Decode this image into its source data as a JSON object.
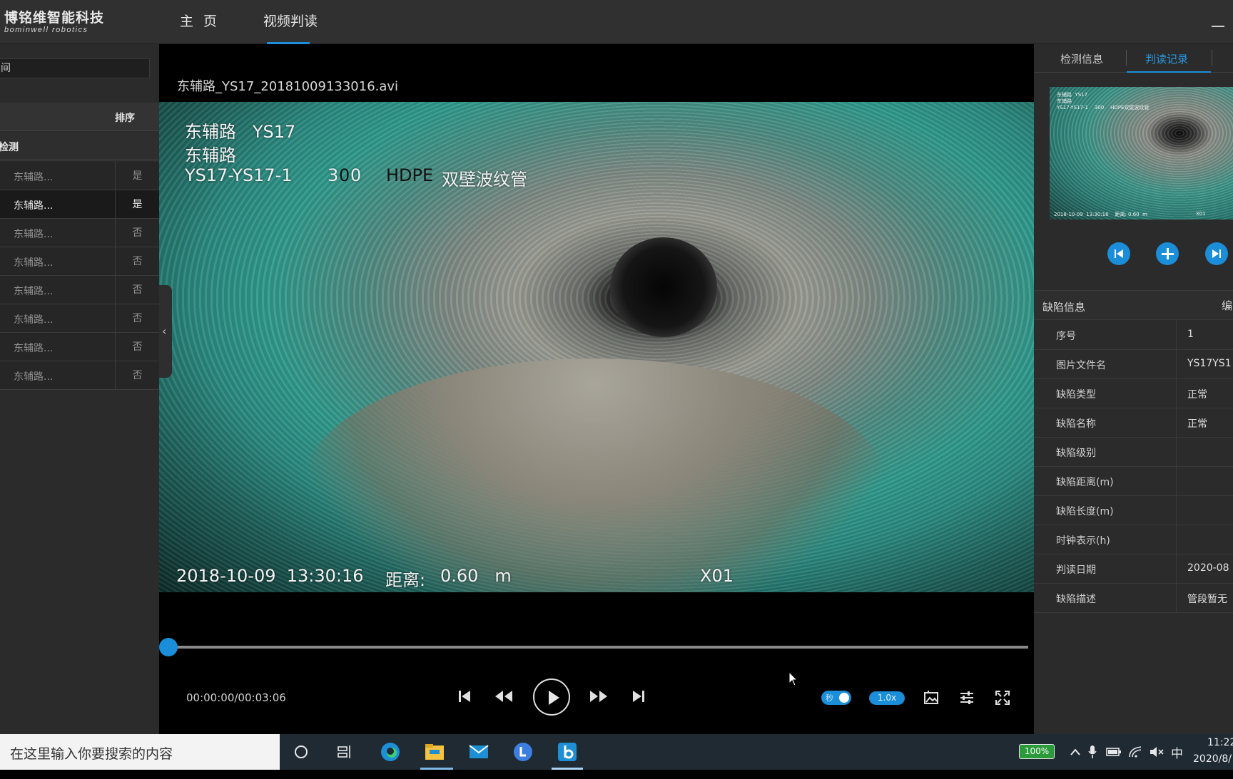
{
  "app": {
    "logo_cn": "博铭维智能科技",
    "logo_en": "bominwell robotics",
    "nav": [
      {
        "label": "主 页"
      },
      {
        "label": "视频判读"
      }
    ],
    "accent": "#1a8ed8"
  },
  "left": {
    "search_value": "间",
    "sort_label": "排序",
    "group_label": "检测",
    "rows": [
      {
        "name": "东辅路...",
        "flag": "是"
      },
      {
        "name": "东辅路...",
        "flag": "是"
      },
      {
        "name": "东辅路...",
        "flag": "否"
      },
      {
        "name": "东辅路...",
        "flag": "否"
      },
      {
        "name": "东辅路...",
        "flag": "否"
      },
      {
        "name": "东辅路...",
        "flag": "否"
      },
      {
        "name": "东辅路...",
        "flag": "否"
      },
      {
        "name": "东辅路...",
        "flag": "否"
      }
    ]
  },
  "video": {
    "filename": "东辅路_YS17_20181009133016.avi",
    "overlay": {
      "line1": "东辅路   YS17",
      "line2": "东辅路",
      "line3a": "YS17-YS17-1",
      "line3b_3": "3",
      "line3b_0a": "0",
      "line3b_0b": "0",
      "line3c": "HDPE",
      "line3d": "双壁波纹管",
      "datetime": "2018-10-09  13:30:16",
      "distance_label": "距离:",
      "distance_value": "0.60   m",
      "code": "X01"
    },
    "time": "00:00:00/00:03:06",
    "progress": 0,
    "toggle_label": "秒",
    "speed": "1.0x"
  },
  "right": {
    "tabs": [
      {
        "label": "检测信息"
      },
      {
        "label": "判读记录"
      }
    ],
    "defect_title": "缺陷信息",
    "edit_label": "编",
    "thumb": {
      "l1": "东辅路  YS17",
      "l2": "东辅路",
      "l3": "YS17-YS17-1    300    HDPE双壁波纹管",
      "l4": "2018-10-09  13:30:16    距离: 0.60  m",
      "l5": "X01"
    },
    "fields": [
      {
        "k": "序号",
        "v": "1"
      },
      {
        "k": "图片文件名",
        "v": "YS17YS1"
      },
      {
        "k": "缺陷类型",
        "v": "正常"
      },
      {
        "k": "缺陷名称",
        "v": "正常"
      },
      {
        "k": "缺陷级别",
        "v": ""
      },
      {
        "k": "缺陷距离(m)",
        "v": ""
      },
      {
        "k": "缺陷长度(m)",
        "v": ""
      },
      {
        "k": "时钟表示(h)",
        "v": ""
      },
      {
        "k": "判读日期",
        "v": "2020-08"
      },
      {
        "k": "缺陷描述",
        "v": "管段暂无"
      }
    ]
  },
  "taskbar": {
    "search_placeholder": "在这里输入你要搜索的内容",
    "battery": "100%",
    "ime": "中",
    "time": "11:22",
    "date": "2020/8/"
  }
}
